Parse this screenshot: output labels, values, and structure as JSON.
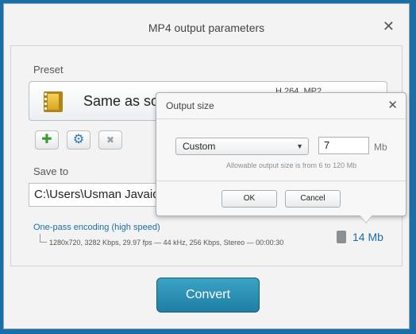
{
  "window": {
    "title": "MP4 output parameters",
    "close_glyph": "✕"
  },
  "preset": {
    "label": "Preset",
    "name": "Same as sou",
    "codec": "H.264, MP2",
    "icon": "film-icon"
  },
  "preset_buttons": {
    "add_glyph": "✚",
    "settings_glyph": "⚙",
    "delete_glyph": "✖"
  },
  "save_to": {
    "label": "Save to",
    "path": "C:\\Users\\Usman Javaid\\"
  },
  "encoding": {
    "mode": "One-pass encoding (high speed)",
    "details": "1280x720, 3282 Kbps, 29.97 fps — 44 kHz, 256 Kbps, Stereo — 00:00:30",
    "size": "14 Mb"
  },
  "convert_label": "Convert",
  "popup": {
    "title": "Output size",
    "close_glyph": "✕",
    "mode": "Custom",
    "mode_options": [
      "Custom"
    ],
    "value": "7",
    "unit": "Mb",
    "allowable": "Allowable output size is from 6 to 120 Mb",
    "ok_label": "OK",
    "cancel_label": "Cancel"
  },
  "colors": {
    "accent": "#1a6fa8",
    "convert_button": "#2b8fb5"
  }
}
